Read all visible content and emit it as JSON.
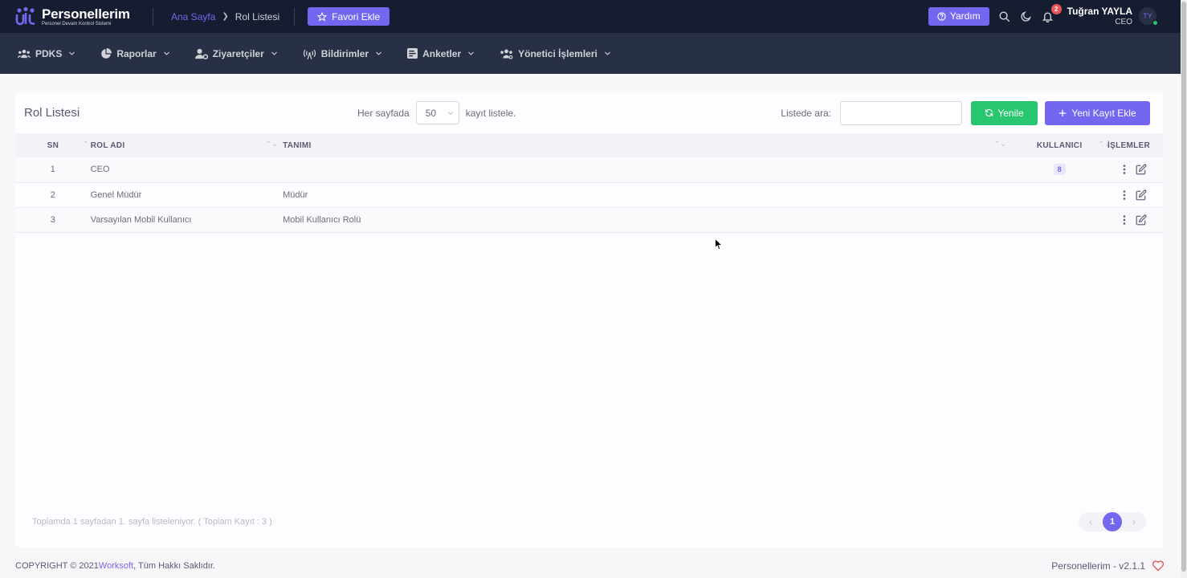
{
  "header": {
    "brand_name": "Personellerim",
    "brand_subtitle": "Personel Devam Kontrol Sistemi",
    "breadcrumb": {
      "home": "Ana Sayfa",
      "current": "Rol Listesi"
    },
    "favorite_label": "Favori Ekle",
    "help_label": "Yardım",
    "notification_count": "2",
    "user": {
      "name": "Tuğran YAYLA",
      "role": "CEO",
      "initials": "TY"
    }
  },
  "nav": {
    "items": [
      {
        "label": "PDKS",
        "icon": "users-icon"
      },
      {
        "label": "Raporlar",
        "icon": "pie-chart-icon"
      },
      {
        "label": "Ziyaretçiler",
        "icon": "user-cog-icon"
      },
      {
        "label": "Bildirimler",
        "icon": "broadcast-icon"
      },
      {
        "label": "Anketler",
        "icon": "poll-icon"
      },
      {
        "label": "Yönetici İşlemleri",
        "icon": "users-cog-icon"
      }
    ]
  },
  "list": {
    "title": "Rol Listesi",
    "per_page_prefix": "Her sayfada",
    "per_page_value": "50",
    "per_page_suffix": "kayıt listele.",
    "search_label": "Listede ara:",
    "search_value": "",
    "refresh_label": "Yenile",
    "new_label": "Yeni Kayıt Ekle",
    "columns": {
      "sn": "SN",
      "rol": "ROL ADI",
      "tanim": "TANIMI",
      "kullanici": "KULLANICI",
      "islemler": "İŞLEMLER"
    },
    "rows": [
      {
        "sn": "1",
        "rol": "CEO",
        "tanim": "",
        "kullanici": "8"
      },
      {
        "sn": "2",
        "rol": "Genel Müdür",
        "tanim": "Müdür",
        "kullanici": ""
      },
      {
        "sn": "3",
        "rol": "Varsayılan Mobil Kullanıcı",
        "tanim": "Mobil Kullanıcı Rolü",
        "kullanici": ""
      }
    ],
    "footer_info": "Toplamda 1 sayfadan 1. sayfa listeleniyor. ( Toplam Kayıt : 3 )",
    "current_page": "1"
  },
  "footer": {
    "copyright_prefix": "COPYRIGHT © 2021 ",
    "company": "Worksoft",
    "copyright_suffix": ", Tüm Hakkı Saklıdır.",
    "version": "Personellerim - v2.1.1"
  },
  "colors": {
    "primary": "#7367f0",
    "success": "#28c76f",
    "danger": "#ea5455",
    "dark_header": "#161d31",
    "dark_nav": "#283046"
  }
}
